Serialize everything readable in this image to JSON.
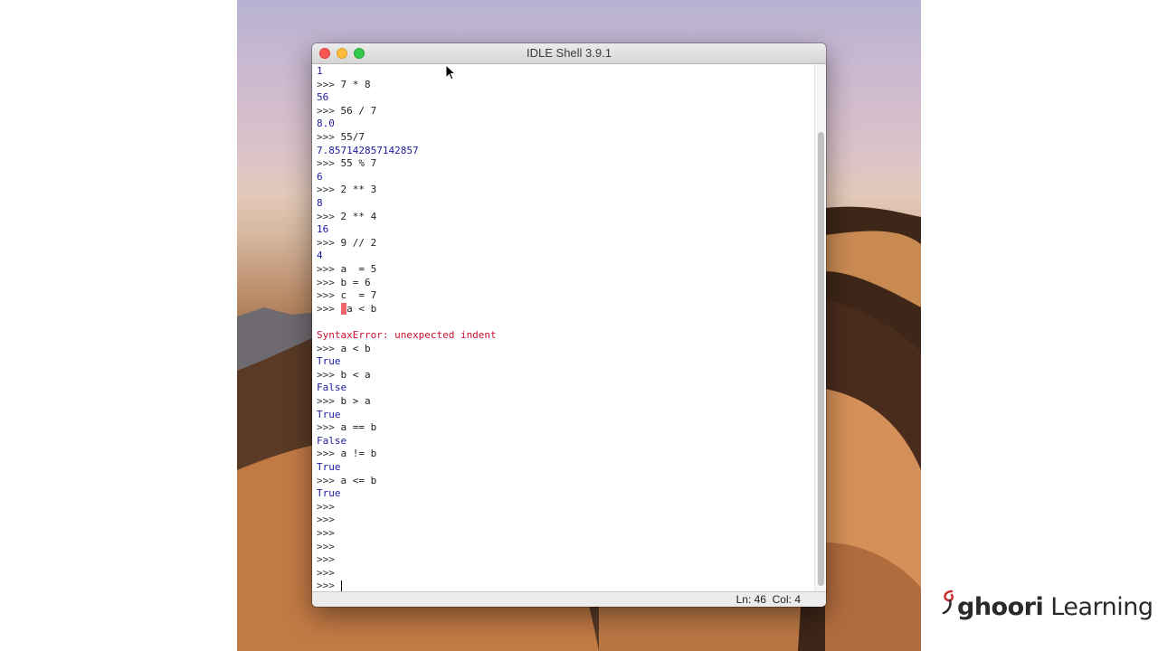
{
  "window": {
    "title": "IDLE Shell 3.9.1"
  },
  "shell_lines": [
    {
      "prompt": "",
      "text": "1",
      "kind": "out"
    },
    {
      "prompt": ">>> ",
      "text": "7 * 8",
      "kind": "inp"
    },
    {
      "prompt": "",
      "text": "56",
      "kind": "out"
    },
    {
      "prompt": ">>> ",
      "text": "56 / 7",
      "kind": "inp"
    },
    {
      "prompt": "",
      "text": "8.0",
      "kind": "out"
    },
    {
      "prompt": ">>> ",
      "text": "55/7",
      "kind": "inp"
    },
    {
      "prompt": "",
      "text": "7.857142857142857",
      "kind": "out"
    },
    {
      "prompt": ">>> ",
      "text": "55 % 7",
      "kind": "inp"
    },
    {
      "prompt": "",
      "text": "6",
      "kind": "out"
    },
    {
      "prompt": ">>> ",
      "text": "2 ** 3",
      "kind": "inp"
    },
    {
      "prompt": "",
      "text": "8",
      "kind": "out"
    },
    {
      "prompt": ">>> ",
      "text": "2 ** 4",
      "kind": "inp"
    },
    {
      "prompt": "",
      "text": "16",
      "kind": "out"
    },
    {
      "prompt": ">>> ",
      "text": "9 // 2",
      "kind": "inp"
    },
    {
      "prompt": "",
      "text": "4",
      "kind": "out"
    },
    {
      "prompt": ">>> ",
      "text": "a  = 5",
      "kind": "inp"
    },
    {
      "prompt": ">>> ",
      "text": "b = 6",
      "kind": "inp"
    },
    {
      "prompt": ">>> ",
      "text": "c  = 7",
      "kind": "inp"
    },
    {
      "prompt": ">>> ",
      "text": "a < b",
      "kind": "indent"
    },
    {
      "prompt": "",
      "text": "",
      "kind": "out"
    },
    {
      "prompt": "",
      "text": "SyntaxError: unexpected indent",
      "kind": "err"
    },
    {
      "prompt": ">>> ",
      "text": "a < b",
      "kind": "inp"
    },
    {
      "prompt": "",
      "text": "True",
      "kind": "out"
    },
    {
      "prompt": ">>> ",
      "text": "b < a",
      "kind": "inp"
    },
    {
      "prompt": "",
      "text": "False",
      "kind": "out"
    },
    {
      "prompt": ">>> ",
      "text": "b > a",
      "kind": "inp"
    },
    {
      "prompt": "",
      "text": "True",
      "kind": "out"
    },
    {
      "prompt": ">>> ",
      "text": "a == b",
      "kind": "inp"
    },
    {
      "prompt": "",
      "text": "False",
      "kind": "out"
    },
    {
      "prompt": ">>> ",
      "text": "a != b",
      "kind": "inp"
    },
    {
      "prompt": "",
      "text": "True",
      "kind": "out"
    },
    {
      "prompt": ">>> ",
      "text": "a <= b",
      "kind": "inp"
    },
    {
      "prompt": "",
      "text": "True",
      "kind": "out"
    },
    {
      "prompt": ">>>",
      "text": "",
      "kind": "inp"
    },
    {
      "prompt": ">>>",
      "text": "",
      "kind": "inp"
    },
    {
      "prompt": ">>>",
      "text": "",
      "kind": "inp"
    },
    {
      "prompt": ">>>",
      "text": "",
      "kind": "inp"
    },
    {
      "prompt": ">>>",
      "text": "",
      "kind": "inp"
    },
    {
      "prompt": ">>>",
      "text": "",
      "kind": "inp"
    },
    {
      "prompt": ">>> ",
      "text": "",
      "kind": "active"
    }
  ],
  "status": {
    "text": "Ln: 46  Col: 4"
  },
  "logo": {
    "prefix": "ghoori",
    "suffix": " Learning"
  },
  "colors": {
    "output": "#1a1aa0",
    "error": "#c8102e",
    "indent_highlight": "#f2636b"
  },
  "icons": [
    "close-icon",
    "minimize-icon",
    "maximize-icon",
    "mouse-pointer-icon",
    "ghoori-logo-icon"
  ]
}
